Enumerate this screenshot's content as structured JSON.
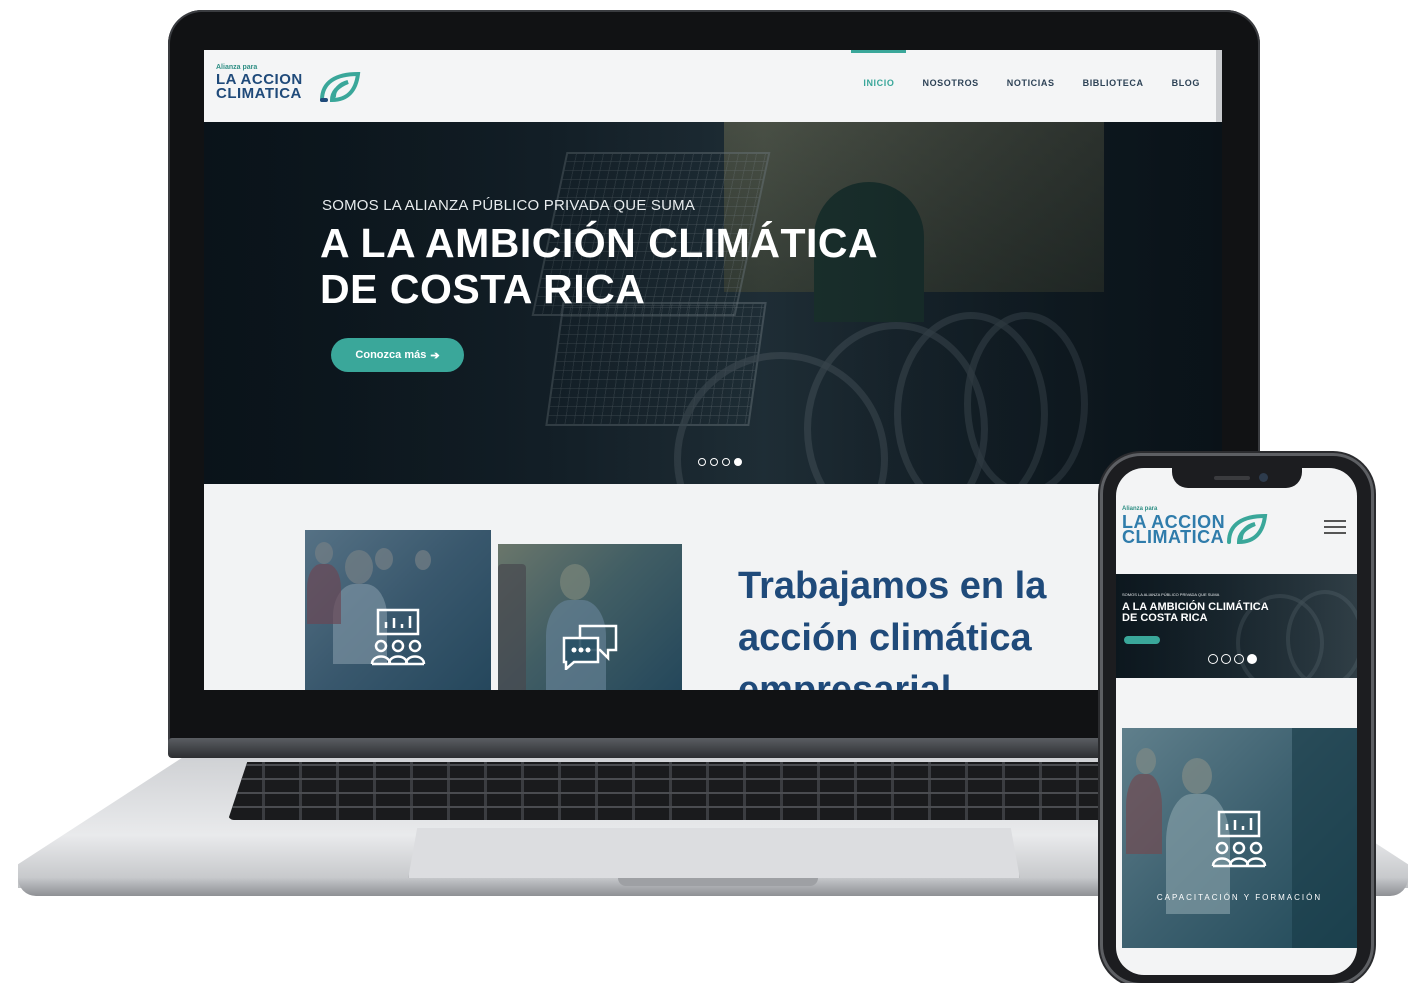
{
  "site": {
    "logo": {
      "small_text": "Alianza para",
      "line1": "LA ACCION",
      "line2": "CLIMATICA",
      "icon": "leaf-swirl-icon"
    },
    "nav": [
      {
        "label": "INICIO",
        "active": true
      },
      {
        "label": "NOSOTROS",
        "active": false
      },
      {
        "label": "NOTICIAS",
        "active": false
      },
      {
        "label": "BIBLIOTECA",
        "active": false
      },
      {
        "label": "BLOG",
        "active": false
      }
    ],
    "hero": {
      "kicker": "SOMOS LA ALIANZA PÚBLICO PRIVADA QUE SUMA",
      "title_line1": "A LA AMBICIÓN CLIMÁTICA",
      "title_line2": "DE COSTA RICA",
      "button_label": "Conozca más",
      "button_icon": "arrow-right-icon",
      "slides_count": 4,
      "active_slide": 4
    },
    "section": {
      "title": "Trabajamos en la acción climática empresarial",
      "cards": [
        {
          "icon": "presentation-group-icon"
        },
        {
          "icon": "chat-bubbles-icon"
        }
      ]
    }
  },
  "phone": {
    "hero": {
      "kicker": "SOMOS LA ALIANZA PÚBLICO PRIVADA QUE SUMA",
      "title_line1": "A LA AMBICIÓN CLIMÁTICA",
      "title_line2": "DE COSTA RICA"
    },
    "menu_icon": "hamburger-menu-icon",
    "card_label": "CAPACITACIÓN Y FORMACIÓN",
    "card_icon": "presentation-group-icon"
  },
  "colors": {
    "teal": "#3aa79a",
    "navy": "#1f4a7a",
    "logo_blue": "#2f7cab"
  }
}
